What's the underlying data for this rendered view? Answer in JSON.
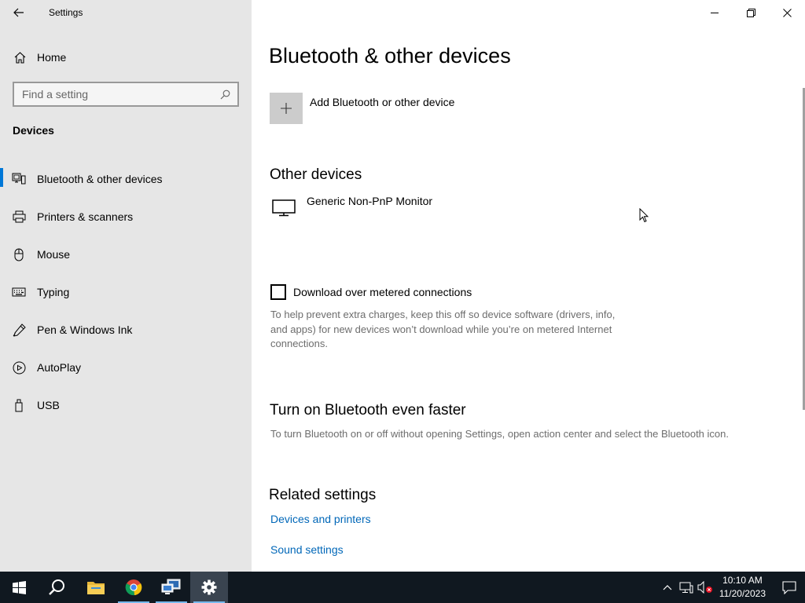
{
  "window": {
    "title": "Settings",
    "controls": {
      "minimize": "minimize",
      "restore": "restore",
      "close": "close"
    }
  },
  "sidebar": {
    "home_label": "Home",
    "search_placeholder": "Find a setting",
    "section_label": "Devices",
    "items": [
      {
        "label": "Bluetooth & other devices",
        "icon": "bluetooth-devices-icon",
        "active": true
      },
      {
        "label": "Printers & scanners",
        "icon": "printer-icon",
        "active": false
      },
      {
        "label": "Mouse",
        "icon": "mouse-icon",
        "active": false
      },
      {
        "label": "Typing",
        "icon": "keyboard-icon",
        "active": false
      },
      {
        "label": "Pen & Windows Ink",
        "icon": "pen-icon",
        "active": false
      },
      {
        "label": "AutoPlay",
        "icon": "autoplay-icon",
        "active": false
      },
      {
        "label": "USB",
        "icon": "usb-icon",
        "active": false
      }
    ]
  },
  "main": {
    "page_title": "Bluetooth & other devices",
    "add_device_label": "Add Bluetooth or other device",
    "other_devices_heading": "Other devices",
    "devices": [
      {
        "label": "Generic Non-PnP Monitor",
        "icon": "monitor-icon"
      }
    ],
    "metered": {
      "label": "Download over metered connections",
      "checked": false,
      "help": "To help prevent extra charges, keep this off so device software (drivers, info, and apps) for new devices won’t download while you’re on metered Internet connections."
    },
    "bt_faster_heading": "Turn on Bluetooth even faster",
    "bt_faster_text": "To turn Bluetooth on or off without opening Settings, open action center and select the Bluetooth icon.",
    "related_heading": "Related settings",
    "related_links": [
      "Devices and printers",
      "Sound settings"
    ]
  },
  "taskbar": {
    "apps": [
      "start-icon",
      "search-icon",
      "file-explorer-icon",
      "chrome-icon",
      "remote-desktop-icon",
      "settings-gear-icon"
    ],
    "clock_time": "10:10 AM",
    "clock_date": "11/20/2023"
  },
  "colors": {
    "accent": "#0078d7",
    "link": "#0067b8",
    "sidebar_bg": "#e6e6e6",
    "taskbar_bg": "#101820"
  }
}
